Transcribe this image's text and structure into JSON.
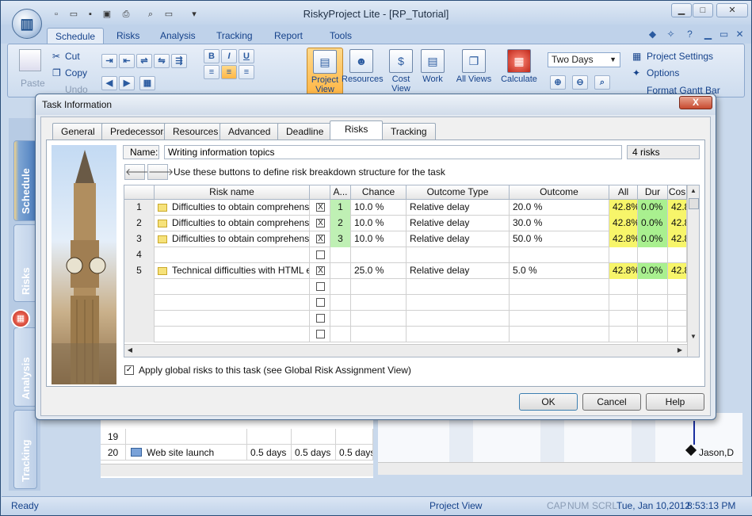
{
  "window": {
    "title": "RiskyProject Lite - [RP_Tutorial]"
  },
  "ribbon_tabs": [
    "Schedule",
    "Risks",
    "Analysis",
    "Tracking",
    "Report",
    "Tools"
  ],
  "ribbon": {
    "cut": "Cut",
    "copy": "Copy",
    "paste": "Paste",
    "undo": "Undo",
    "project_view": "Project View",
    "resources": "Resources",
    "cost_view": "Cost View",
    "work": "Work",
    "all_views": "All Views",
    "calculate": "Calculate",
    "zoom_value": "Two Days",
    "project_settings": "Project Settings",
    "options": "Options",
    "format_gantt_bar": "Format Gantt Bar"
  },
  "vertical_nav": [
    "Schedule",
    "Risks",
    "Analysis",
    "Tracking"
  ],
  "dialog": {
    "title": "Task Information",
    "close": "X",
    "tabs": [
      "General",
      "Predecessors",
      "Resources",
      "Advanced",
      "Deadline",
      "Risks",
      "Tracking"
    ],
    "active_tab": "Risks",
    "name_label": "Name:",
    "name_value": "Writing information topics",
    "risk_count": "4 risks",
    "nav_help": "Use these buttons to define risk breakdown structure for the task",
    "columns": [
      "Risk name",
      "A...",
      "Chance",
      "Outcome Type",
      "Outcome",
      "All",
      "Dur",
      "Cos"
    ],
    "rows": [
      {
        "num": "1",
        "name": "Difficulties to obtain comprehensive",
        "checked": "X",
        "a": "1",
        "chance": "10.0 %",
        "type": "Relative delay",
        "outcome": "20.0 %",
        "all": "42.8%",
        "dur": "0.0%",
        "cost": "42.8"
      },
      {
        "num": "2",
        "name": "Difficulties to obtain comprehensive",
        "checked": "X",
        "a": "2",
        "chance": "10.0 %",
        "type": "Relative delay",
        "outcome": "30.0 %",
        "all": "42.8%",
        "dur": "0.0%",
        "cost": "42.8"
      },
      {
        "num": "3",
        "name": "Difficulties to obtain comprehensive",
        "checked": "X",
        "a": "3",
        "chance": "10.0 %",
        "type": "Relative delay",
        "outcome": "50.0 %",
        "all": "42.8%",
        "dur": "0.0%",
        "cost": "42.8"
      },
      {
        "num": "4",
        "name": "",
        "checked": "",
        "a": "",
        "chance": "",
        "type": "",
        "outcome": "",
        "all": "",
        "dur": "",
        "cost": ""
      },
      {
        "num": "5",
        "name": "Technical difficulties with HTML edi",
        "checked": "X",
        "a": "",
        "chance": "25.0 %",
        "type": "Relative delay",
        "outcome": "5.0 %",
        "all": "42.8%",
        "dur": "0.0%",
        "cost": "42.8"
      }
    ],
    "global_risks_label": "Apply global risks to this task (see Global Risk Assignment View)",
    "ok": "OK",
    "cancel": "Cancel",
    "help": "Help"
  },
  "background_grid": [
    {
      "num": "19",
      "name": "",
      "c1": "",
      "c2": "",
      "c3": ""
    },
    {
      "num": "20",
      "name": "Web site launch",
      "c1": "0.5 days",
      "c2": "0.5 days",
      "c3": "0.5 days"
    }
  ],
  "gantt_label": "Jason,D",
  "status": {
    "ready": "Ready",
    "view": "Project View",
    "cap": "CAP",
    "num": "NUM",
    "scrl": "SCRL",
    "date": "Tue, Jan 10,2012",
    "time": "8:53:13 PM"
  }
}
